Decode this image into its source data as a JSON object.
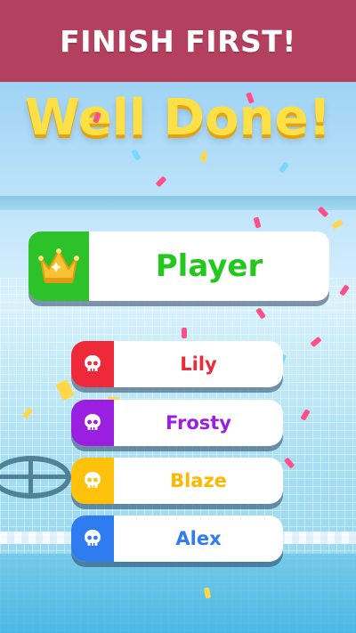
{
  "banner": {
    "text": "FINISH FIRST!"
  },
  "result": {
    "title": "Well Done!"
  },
  "winner": {
    "name": "Player",
    "icon": "crown-icon",
    "color": "#23c81c",
    "badge_color": "#2ec22a"
  },
  "ranking": [
    {
      "name": "Lily",
      "icon": "skull-icon",
      "badge_color": "#ee2a3a",
      "text_color": "#ee2a3a"
    },
    {
      "name": "Frosty",
      "icon": "skull-icon",
      "badge_color": "#9a1fe0",
      "text_color": "#9a1fe0"
    },
    {
      "name": "Blaze",
      "icon": "skull-icon",
      "badge_color": "#ffc20a",
      "text_color": "#ffb800"
    },
    {
      "name": "Alex",
      "icon": "skull-icon",
      "badge_color": "#2e7cf0",
      "text_color": "#2e7cf0"
    }
  ],
  "colors": {
    "banner": "#b4405f",
    "title": "#fde046",
    "title_shadow": "#e6a20c"
  }
}
